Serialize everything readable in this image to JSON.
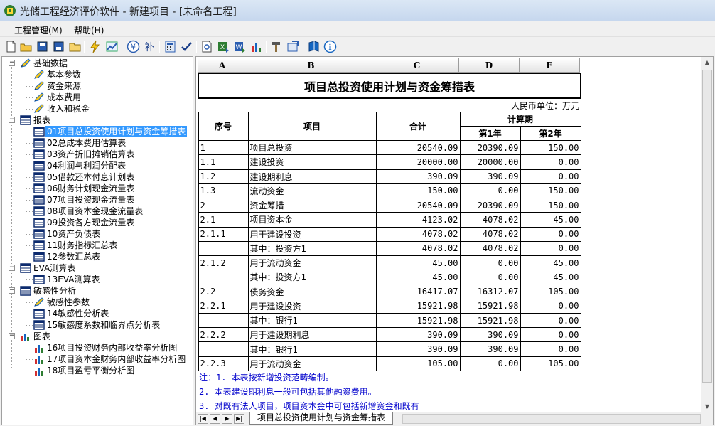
{
  "window": {
    "title": "光储工程经济评价软件 - 新建项目 - [未命名工程]"
  },
  "menu": {
    "items": [
      "工程管理(M)",
      "帮助(H)"
    ]
  },
  "toolbar": {
    "buttons": [
      "new-file-icon",
      "open-folder-icon",
      "save-icon",
      "save-all-icon",
      "folder-icon",
      "lightning-icon",
      "chart-line-icon",
      "currency-icon",
      "people-icon",
      "calculator-icon",
      "check-icon",
      "preview-icon",
      "export-excel-icon",
      "export-word-icon",
      "bar-chart-icon",
      "hammer-icon",
      "export-icon",
      "book-icon",
      "info-icon"
    ]
  },
  "tree": {
    "groups": [
      {
        "label": "基础数据",
        "icon": "pencil-icon",
        "items": [
          "基本参数",
          "资金来源",
          "成本费用",
          "收入和税金"
        ]
      },
      {
        "label": "报表",
        "icon": "table-icon",
        "items": [
          "01项目总投资使用计划与资金筹措表",
          "02总成本费用估算表",
          "03资产折旧摊销估算表",
          "04利润与利润分配表",
          "05借款还本付息计划表",
          "06财务计划现金流量表",
          "07项目投资现金流量表",
          "08项目资本金现金流量表",
          "09投资各方现金流量表",
          "10资产负债表",
          "11财务指标汇总表",
          "12参数汇总表"
        ]
      },
      {
        "label": "EVA测算表",
        "icon": "table-icon",
        "items": [
          "13EVA测算表"
        ]
      },
      {
        "label": "敏感性分析",
        "icon": "table-icon",
        "items": [
          "敏感性参数",
          "14敏感性分析表",
          "15敏感度系数和临界点分析表"
        ]
      },
      {
        "label": "图表",
        "icon": "bar-chart-icon",
        "items": [
          "16项目投资财务内部收益率分析图",
          "17项目资本金财务内部收益率分析图",
          "18项目盈亏平衡分析图"
        ]
      }
    ],
    "selected": "01项目总投资使用计划与资金筹措表"
  },
  "sheet": {
    "columns": [
      "A",
      "B",
      "C",
      "D",
      "E"
    ],
    "title": "项目总投资使用计划与资金筹措表",
    "unit": "人民币单位：万元",
    "header": {
      "seq": "序号",
      "item": "项目",
      "total": "合计",
      "period": "计算期",
      "year1": "第1年",
      "year2": "第2年"
    },
    "rows": [
      [
        "1",
        "项目总投资",
        "20540.09",
        "20390.09",
        "150.00"
      ],
      [
        "1.1",
        "建设投资",
        "20000.00",
        "20000.00",
        "0.00"
      ],
      [
        "1.2",
        "建设期利息",
        "390.09",
        "390.09",
        "0.00"
      ],
      [
        "1.3",
        "流动资金",
        "150.00",
        "0.00",
        "150.00"
      ],
      [
        "2",
        "资金筹措",
        "20540.09",
        "20390.09",
        "150.00"
      ],
      [
        "2.1",
        "项目资本金",
        "4123.02",
        "4078.02",
        "45.00"
      ],
      [
        "2.1.1",
        "用于建设投资",
        "4078.02",
        "4078.02",
        "0.00"
      ],
      [
        "",
        "其中：投资方1",
        "4078.02",
        "4078.02",
        "0.00"
      ],
      [
        "2.1.2",
        "用于流动资金",
        "45.00",
        "0.00",
        "45.00"
      ],
      [
        "",
        "其中：投资方1",
        "45.00",
        "0.00",
        "45.00"
      ],
      [
        "2.2",
        "债务资金",
        "16417.07",
        "16312.07",
        "105.00"
      ],
      [
        "2.2.1",
        "用于建设投资",
        "15921.98",
        "15921.98",
        "0.00"
      ],
      [
        "",
        "其中：银行1",
        "15921.98",
        "15921.98",
        "0.00"
      ],
      [
        "2.2.2",
        "用于建设期利息",
        "390.09",
        "390.09",
        "0.00"
      ],
      [
        "",
        "其中：银行1",
        "390.09",
        "390.09",
        "0.00"
      ],
      [
        "2.2.3",
        "用于流动资金",
        "105.00",
        "0.00",
        "105.00"
      ]
    ],
    "notes": [
      "注：1.  本表按新增投资范畴编制。",
      "    2.  本表建设期利息一般可包括其他融资费用。",
      "    3.  对既有法人项目，项目资本金中可包括新增资金和既有"
    ],
    "tab_label": "项目总投资使用计划与资金筹措表"
  },
  "colors": {
    "selection": "#3399ff",
    "note_text": "#0000cc"
  }
}
